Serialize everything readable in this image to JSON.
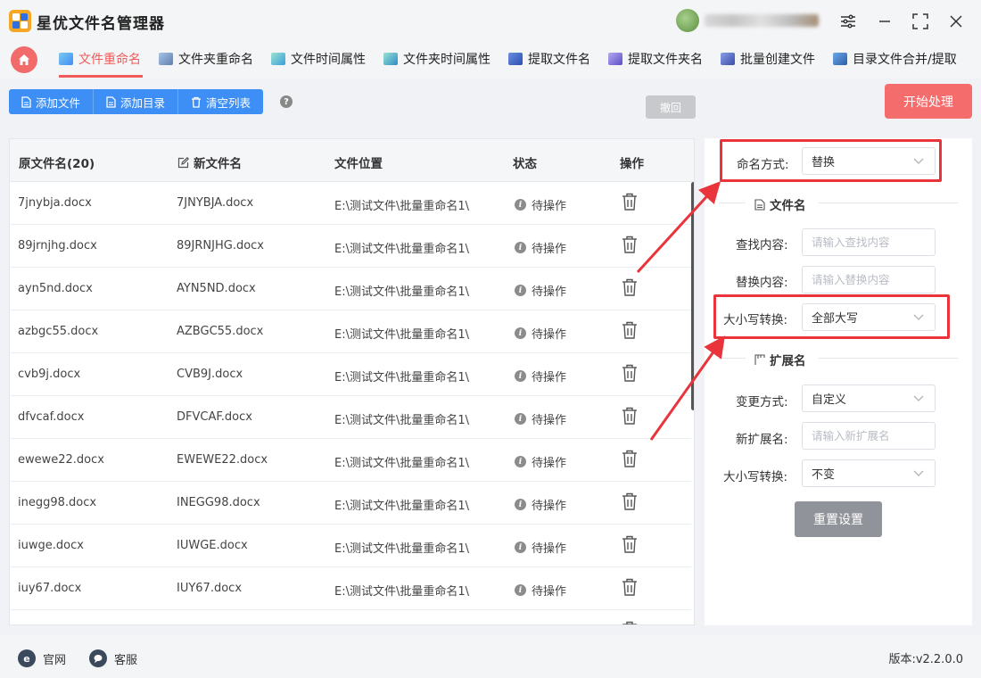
{
  "app": {
    "title": "星优文件名管理器"
  },
  "tabs": [
    {
      "label": "文件重命名",
      "active": true,
      "icon": "rename-file-icon"
    },
    {
      "label": "文件夹重命名",
      "active": false,
      "icon": "rename-folder-icon"
    },
    {
      "label": "文件时间属性",
      "active": false,
      "icon": "file-time-icon"
    },
    {
      "label": "文件夹时间属性",
      "active": false,
      "icon": "folder-time-icon"
    },
    {
      "label": "提取文件名",
      "active": false,
      "icon": "extract-filename-icon"
    },
    {
      "label": "提取文件夹名",
      "active": false,
      "icon": "extract-foldername-icon"
    },
    {
      "label": "批量创建文件",
      "active": false,
      "icon": "batch-create-icon"
    },
    {
      "label": "目录文件合并/提取",
      "active": false,
      "icon": "merge-extract-icon"
    }
  ],
  "toolbar": {
    "add_file": "添加文件",
    "add_dir": "添加目录",
    "clear_list": "清空列表",
    "undo": "撤回",
    "start": "开始处理"
  },
  "table": {
    "headers": {
      "original": "原文件名(20)",
      "new": "新文件名",
      "location": "文件位置",
      "status": "状态",
      "action": "操作"
    },
    "rows": [
      {
        "original": "7jnybja.docx",
        "new": "7JNYBJA.docx",
        "location": "E:\\测试文件\\批量重命名1\\",
        "status": "待操作"
      },
      {
        "original": "89jrnjhg.docx",
        "new": "89JRNJHG.docx",
        "location": "E:\\测试文件\\批量重命名1\\",
        "status": "待操作"
      },
      {
        "original": "ayn5nd.docx",
        "new": "AYN5ND.docx",
        "location": "E:\\测试文件\\批量重命名1\\",
        "status": "待操作"
      },
      {
        "original": "azbgc55.docx",
        "new": "AZBGC55.docx",
        "location": "E:\\测试文件\\批量重命名1\\",
        "status": "待操作"
      },
      {
        "original": "cvb9j.docx",
        "new": "CVB9J.docx",
        "location": "E:\\测试文件\\批量重命名1\\",
        "status": "待操作"
      },
      {
        "original": "dfvcaf.docx",
        "new": "DFVCAF.docx",
        "location": "E:\\测试文件\\批量重命名1\\",
        "status": "待操作"
      },
      {
        "original": "ewewe22.docx",
        "new": "EWEWE22.docx",
        "location": "E:\\测试文件\\批量重命名1\\",
        "status": "待操作"
      },
      {
        "original": "inegg98.docx",
        "new": "INEGG98.docx",
        "location": "E:\\测试文件\\批量重命名1\\",
        "status": "待操作"
      },
      {
        "original": "iuwge.docx",
        "new": "IUWGE.docx",
        "location": "E:\\测试文件\\批量重命名1\\",
        "status": "待操作"
      },
      {
        "original": "iuy67.docx",
        "new": "IUY67.docx",
        "location": "E:\\测试文件\\批量重命名1\\",
        "status": "待操作"
      }
    ]
  },
  "settings": {
    "naming_mode_label": "命名方式:",
    "naming_mode_value": "替换",
    "filename_section": "文件名",
    "find_label": "查找内容:",
    "find_placeholder": "请输入查找内容",
    "replace_label": "替换内容:",
    "replace_placeholder": "请输入替换内容",
    "case_label": "大小写转换:",
    "case_value": "全部大写",
    "ext_section": "扩展名",
    "ext_mode_label": "变更方式:",
    "ext_mode_value": "自定义",
    "new_ext_label": "新扩展名:",
    "new_ext_placeholder": "请输入新扩展名",
    "ext_case_label": "大小写转换:",
    "ext_case_value": "不变",
    "reset": "重置设置"
  },
  "footer": {
    "website": "官网",
    "support": "客服",
    "version": "版本:v2.2.0.0"
  },
  "colors": {
    "accent_red": "#f05a5a",
    "primary_blue": "#3d8ff5",
    "highlight_box": "#e8343a"
  }
}
